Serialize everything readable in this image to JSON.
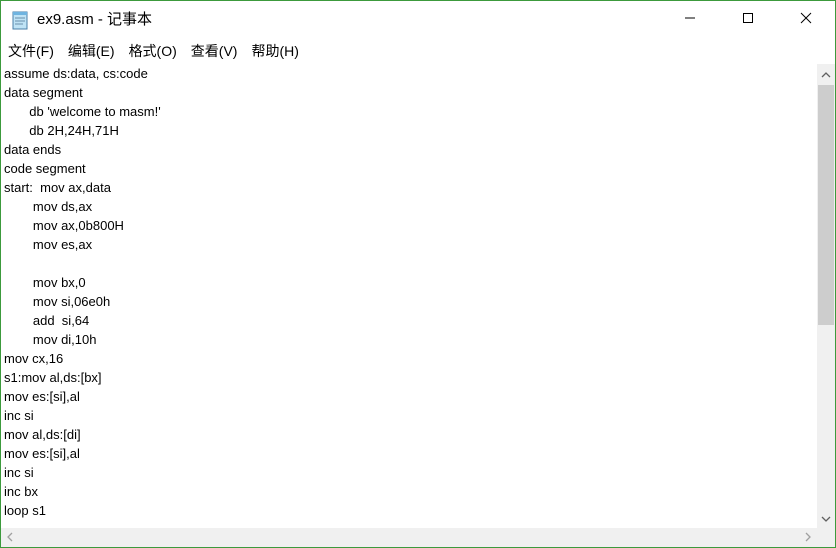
{
  "window": {
    "title": "ex9.asm - 记事本",
    "app_icon": "notepad-icon",
    "controls": {
      "minimize_icon": "minimize-icon",
      "maximize_icon": "maximize-icon",
      "close_icon": "close-icon"
    }
  },
  "menu": {
    "items": [
      {
        "label": "文件(F)"
      },
      {
        "label": "编辑(E)"
      },
      {
        "label": "格式(O)"
      },
      {
        "label": "查看(V)"
      },
      {
        "label": "帮助(H)"
      }
    ]
  },
  "editor": {
    "lines": [
      "assume ds:data, cs:code",
      "data segment",
      "       db 'welcome to masm!'",
      "       db 2H,24H,71H",
      "data ends",
      "code segment",
      "start:  mov ax,data",
      "        mov ds,ax",
      "        mov ax,0b800H",
      "        mov es,ax",
      "",
      "        mov bx,0",
      "        mov si,06e0h",
      "        add  si,64",
      "        mov di,10h",
      "mov cx,16",
      "s1:mov al,ds:[bx]",
      "mov es:[si],al",
      "inc si",
      "mov al,ds:[di]",
      "mov es:[si],al",
      "inc si",
      "inc bx",
      "loop s1"
    ]
  },
  "colors": {
    "window_border": "#3c9a3c",
    "scrollbar_track": "#f0f0f0",
    "scrollbar_thumb": "#cdcdcd"
  }
}
